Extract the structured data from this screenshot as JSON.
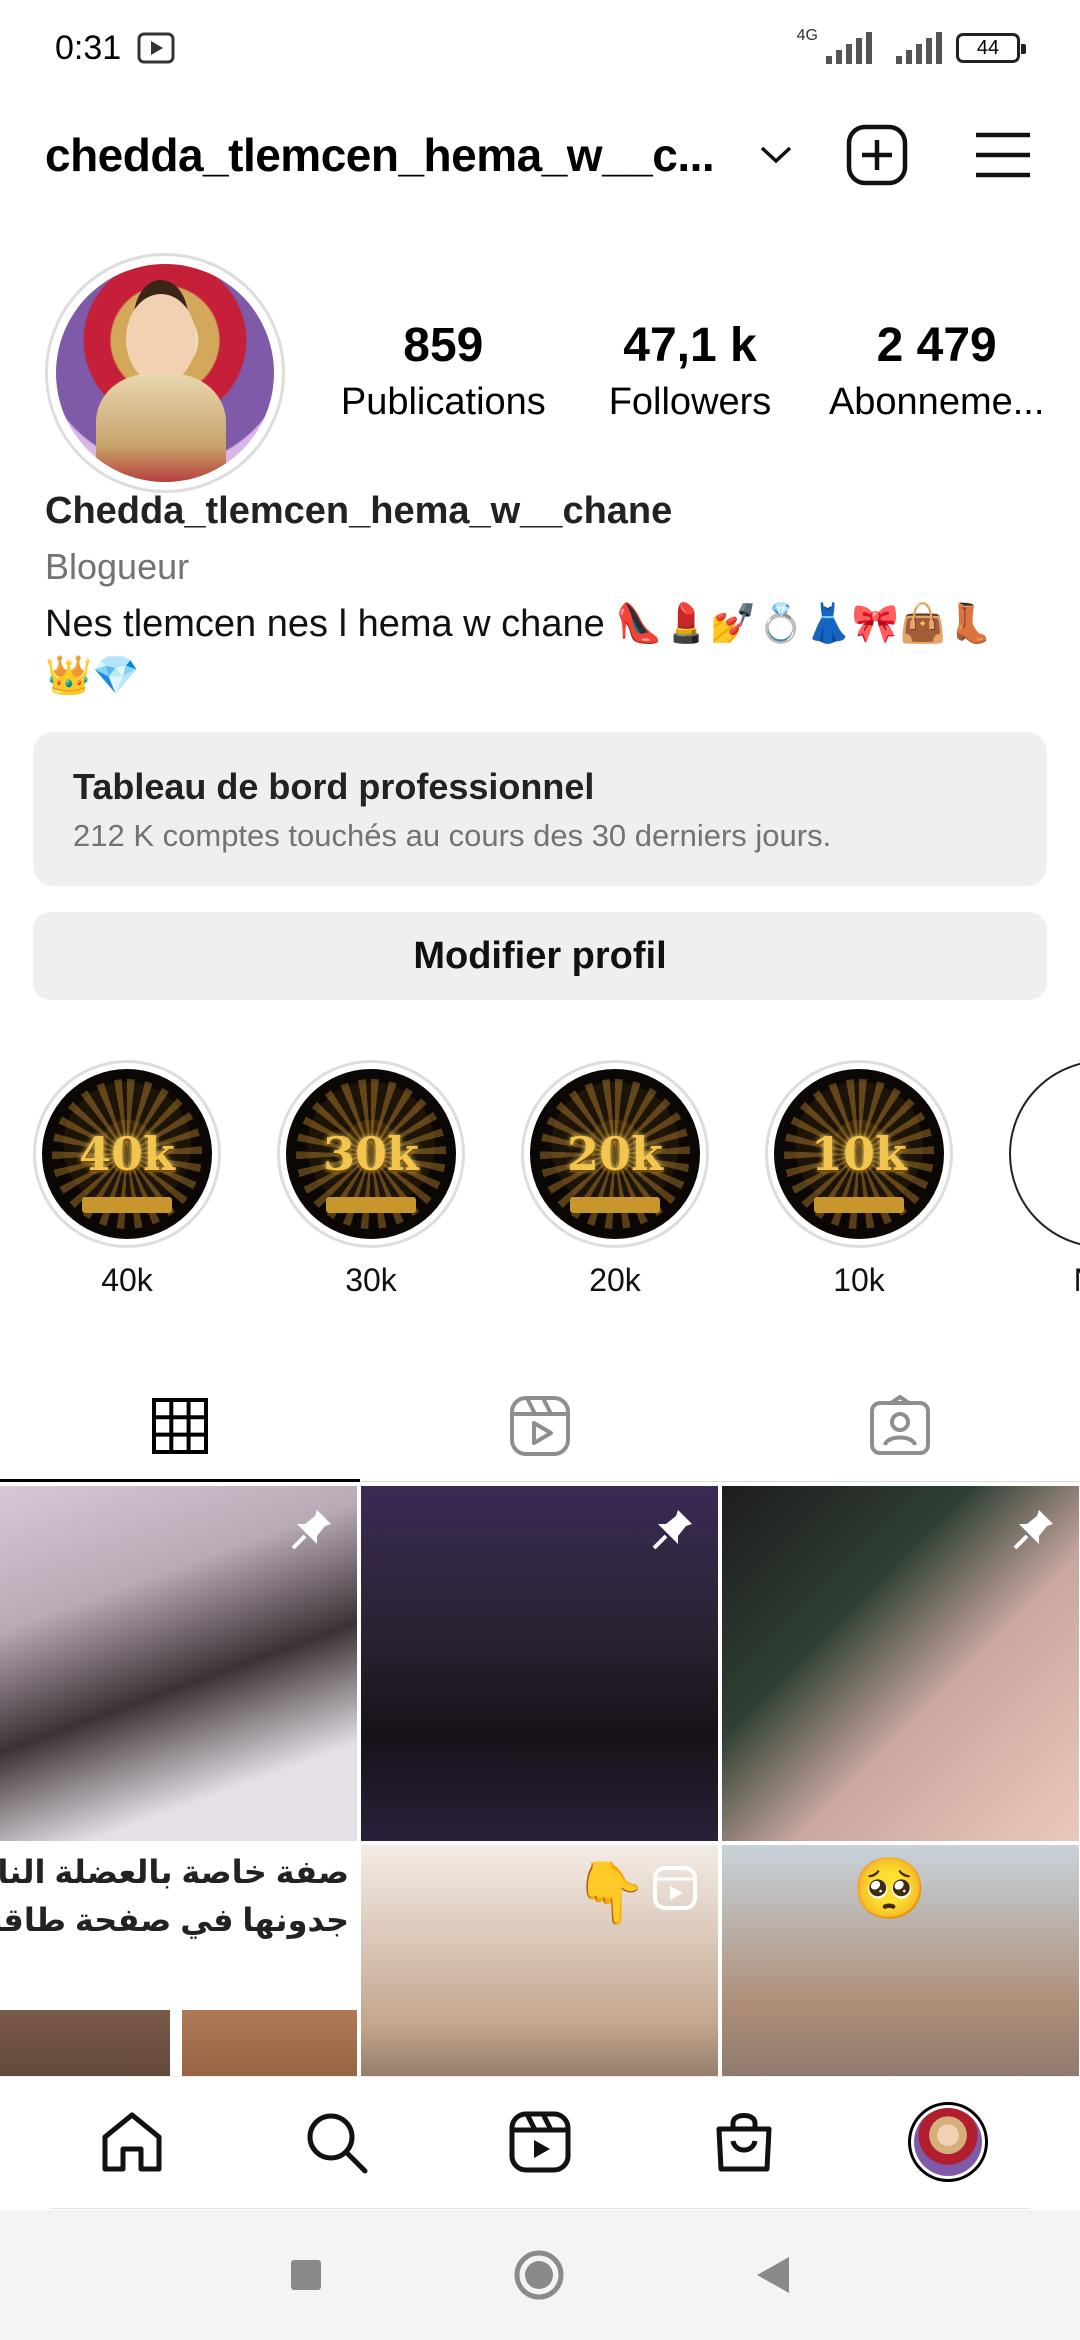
{
  "status_bar": {
    "time": "0:31",
    "network": "4G",
    "battery": "44"
  },
  "header": {
    "username": "chedda_tlemcen_hema_w__c..."
  },
  "profile": {
    "stats": [
      {
        "value": "859",
        "label": "Publications"
      },
      {
        "value": "47,1 k",
        "label": "Followers"
      },
      {
        "value": "2 479",
        "label": "Abonneme..."
      }
    ],
    "full_name": "Chedda_tlemcen_hema_w__chane",
    "category": "Blogueur",
    "bio_line1": "Nes tlemcen nes l hema w chane 👠💄💅💍👗🎀👜👢",
    "bio_line2": "👑💎"
  },
  "dashboard": {
    "title": "Tableau de bord professionnel",
    "subtitle": "212 K comptes touchés au cours des 30 derniers jours."
  },
  "edit_profile_label": "Modifier profil",
  "highlights": [
    {
      "badge": "40k",
      "label": "40k"
    },
    {
      "badge": "30k",
      "label": "30k"
    },
    {
      "badge": "20k",
      "label": "20k"
    },
    {
      "badge": "10k",
      "label": "10k"
    },
    {
      "badge": "+",
      "label": "Nou"
    }
  ],
  "tabs": [
    "grid",
    "reels",
    "tagged"
  ],
  "grid": {
    "arabic_line1": "صفة خاصة بالعضلة النائمة",
    "arabic_line2": "جدونها في صفحة طاقيتها"
  },
  "colors": {
    "accent": "#000000",
    "muted": "#737373",
    "surface": "#efefef"
  }
}
